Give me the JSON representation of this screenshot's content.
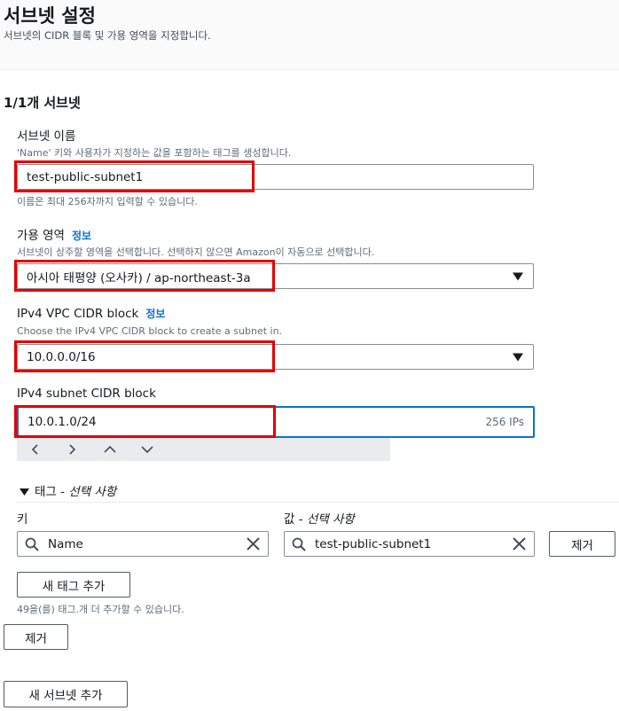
{
  "header": {
    "title": "서브넷 설정",
    "description": "서브넷의 CIDR 블록 및 가용 영역을 지정합니다."
  },
  "subnet": {
    "heading": "1/1개 서브넷",
    "name": {
      "label": "서브넷 이름",
      "hint": "'Name' 키와 사용자가 지정하는 값을 포함하는 태그를 생성합니다.",
      "value": "test-public-subnet1",
      "constraint": "이름은 최대 256자까지 입력할 수 있습니다."
    },
    "az": {
      "label": "가용 영역",
      "info": "정보",
      "hint": "서브넷이 상주할 영역을 선택합니다. 선택하지 않으면 Amazon이 자동으로 선택합니다.",
      "value": "아시아 태평양 (오사카) / ap-northeast-3a"
    },
    "vpc_cidr": {
      "label": "IPv4 VPC CIDR block",
      "info": "정보",
      "hint": "Choose the IPv4 VPC CIDR block to create a subnet in.",
      "value": "10.0.0.0/16"
    },
    "subnet_cidr": {
      "label": "IPv4 subnet CIDR block",
      "value": "10.0.1.0/24",
      "ip_count": "256 IPs"
    },
    "stepper": {
      "prev": "<",
      "next": ">",
      "up": "^",
      "down": "v"
    },
    "tags": {
      "toggle_icon": "caret-down-icon",
      "heading_prefix": "태그 - ",
      "heading_optional": "선택 사항",
      "key_label": "키",
      "value_label_prefix": "값 - ",
      "value_label_optional": "선택 사항",
      "key_value": "Name",
      "value_value": "test-public-subnet1",
      "remove_label": "제거",
      "add_label": "새 태그 추가",
      "limit_text": "49을(를) 태그.개 더 추가할 수 있습니다."
    },
    "remove_subnet_label": "제거"
  },
  "add_subnet_label": "새 서브넷 추가",
  "colors": {
    "highlight": "#e10000",
    "link": "#0972d3",
    "focus": "#0972d3"
  }
}
